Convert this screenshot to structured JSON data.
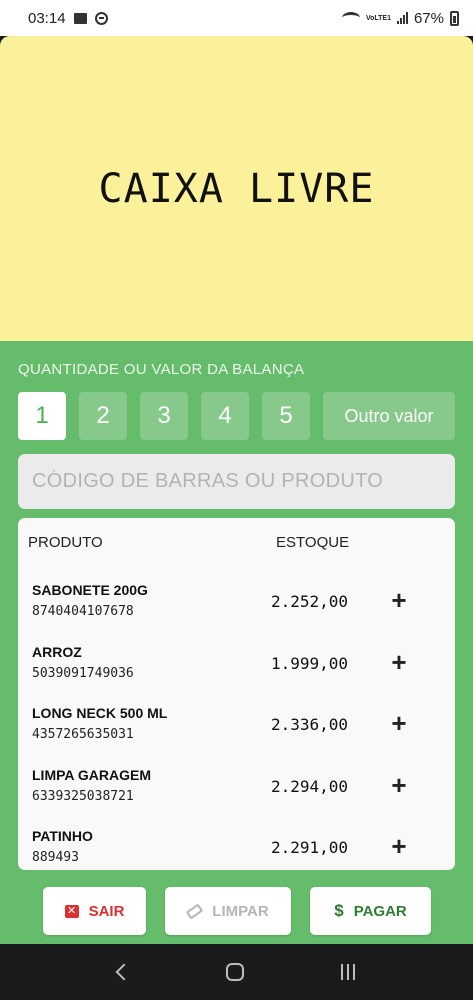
{
  "status_bar": {
    "time": "03:14",
    "network_label": "VoLTE1",
    "battery": "67%"
  },
  "banner": {
    "title": "CAIXA LIVRE"
  },
  "quantity": {
    "label": "QUANTIDADE OU VALOR DA BALANÇA",
    "options": [
      "1",
      "2",
      "3",
      "4",
      "5"
    ],
    "selected": "1",
    "other_label": "Outro valor"
  },
  "search": {
    "placeholder": "CÓDIGO DE BARRAS OU PRODUTO"
  },
  "table": {
    "headers": {
      "product": "PRODUTO",
      "stock": "ESTOQUE"
    },
    "rows": [
      {
        "name": "SABONETE 200G",
        "code": "8740404107678",
        "stock": "2.252,00"
      },
      {
        "name": "ARROZ",
        "code": "5039091749036",
        "stock": "1.999,00"
      },
      {
        "name": "LONG NECK 500 ML",
        "code": "4357265635031",
        "stock": "2.336,00"
      },
      {
        "name": "LIMPA GARAGEM",
        "code": "6339325038721",
        "stock": "2.294,00"
      },
      {
        "name": "PATINHO",
        "code": "889493",
        "stock": "2.291,00"
      }
    ],
    "add_icon": "+"
  },
  "actions": {
    "exit_label": "SAIR",
    "clear_label": "LIMPAR",
    "pay_label": "PAGAR",
    "dollar_symbol": "$"
  },
  "colors": {
    "background_green": "#65bc6b",
    "banner_yellow": "#fbf19b",
    "exit_red": "#d9312f",
    "pay_green": "#2e7d32"
  }
}
